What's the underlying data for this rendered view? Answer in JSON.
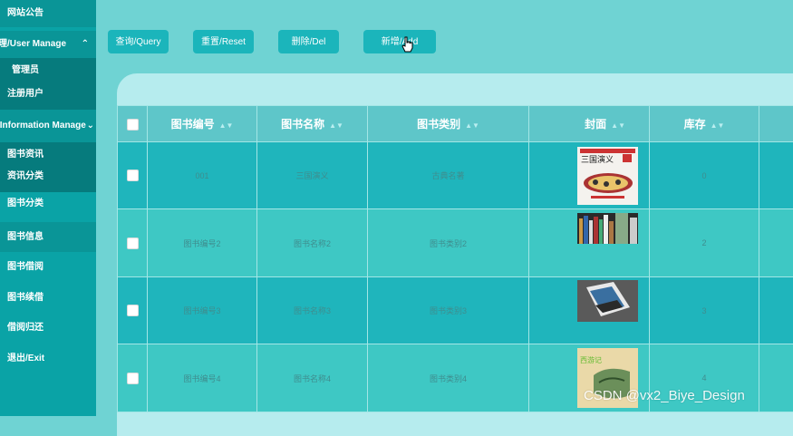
{
  "sidebar": {
    "announcement": "网站公告",
    "user_group": "管理/User Manage",
    "admins": "管理员",
    "registered_users": "注册用户",
    "info_group": "/Information Manage",
    "book_news": "图书资讯",
    "news_category": "资讯分类",
    "book_category": "图书分类",
    "book_info": "图书信息",
    "book_borrow": "图书借阅",
    "book_renew": "图书续借",
    "borrow_return": "借阅归还",
    "logout": "退出/Exit"
  },
  "toolbar": {
    "query": "查询/Query",
    "reset": "重置/Reset",
    "delete": "删除/Del",
    "add": "新增/Add"
  },
  "table": {
    "headers": {
      "code": "图书编号",
      "name": "图书名称",
      "category": "图书类别",
      "cover": "封面",
      "stock": "库存"
    },
    "rows": [
      {
        "code": "001",
        "name": "三国演义",
        "category": "古典名著",
        "stock": "0",
        "cover_title": "三国演义"
      },
      {
        "code": "图书编号2",
        "name": "图书名称2",
        "category": "图书类别2",
        "stock": "2"
      },
      {
        "code": "图书编号3",
        "name": "图书名称3",
        "category": "图书类别3",
        "stock": "3"
      },
      {
        "code": "图书编号4",
        "name": "图书名称4",
        "category": "图书类别4",
        "stock": "4",
        "cover_title": "西游记"
      }
    ]
  },
  "watermark": "CSDN @vx2_Biye_Design",
  "colors": {
    "sidebar": "#0aa3a6",
    "sidebar_dark": "#067b7d",
    "button": "#1bb5bb",
    "background": "#6fd3d3",
    "header": "#5ec6c9"
  }
}
